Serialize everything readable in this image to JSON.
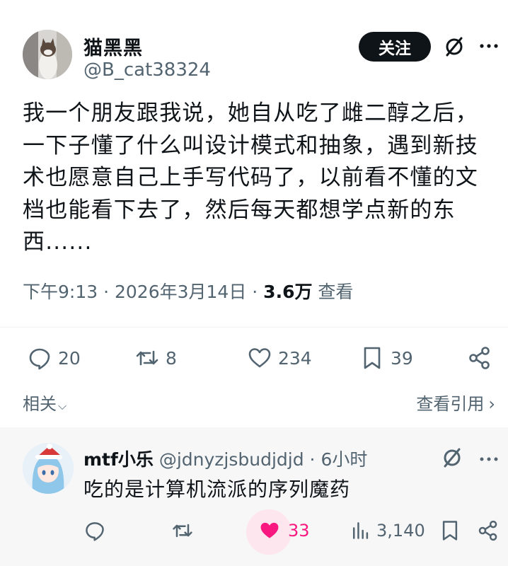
{
  "post": {
    "author_name": "猫黑黑",
    "author_handle": "@B_cat38324",
    "follow_label": "关注",
    "text": "我一个朋友跟我说，她自从吃了雌二醇之后，一下子懂了什么叫设计模式和抽象，遇到新技术也愿意自己上手写代码了，以前看不懂的文档也能看下去了，然后每天都想学点新的东西......",
    "time": "下午9:13 · 2026年3月14日 · ",
    "views": "3.6万",
    "views_label": " 查看",
    "stats": {
      "replies": "20",
      "reposts": "8",
      "likes": "234",
      "bookmarks": "39"
    },
    "related_label": "相关",
    "view_quotes_label": "查看引用"
  },
  "reply": {
    "author_name": "mtf小乐",
    "author_handle": "@jdnyzjsbudjdjd",
    "time": " · 6小时",
    "text": "吃的是计算机流派的序列魔药",
    "stats": {
      "likes": "33",
      "views": "3,140"
    }
  },
  "colors": {
    "text": "#0f1419",
    "secondary": "#536471",
    "like_active": "#f91880"
  }
}
